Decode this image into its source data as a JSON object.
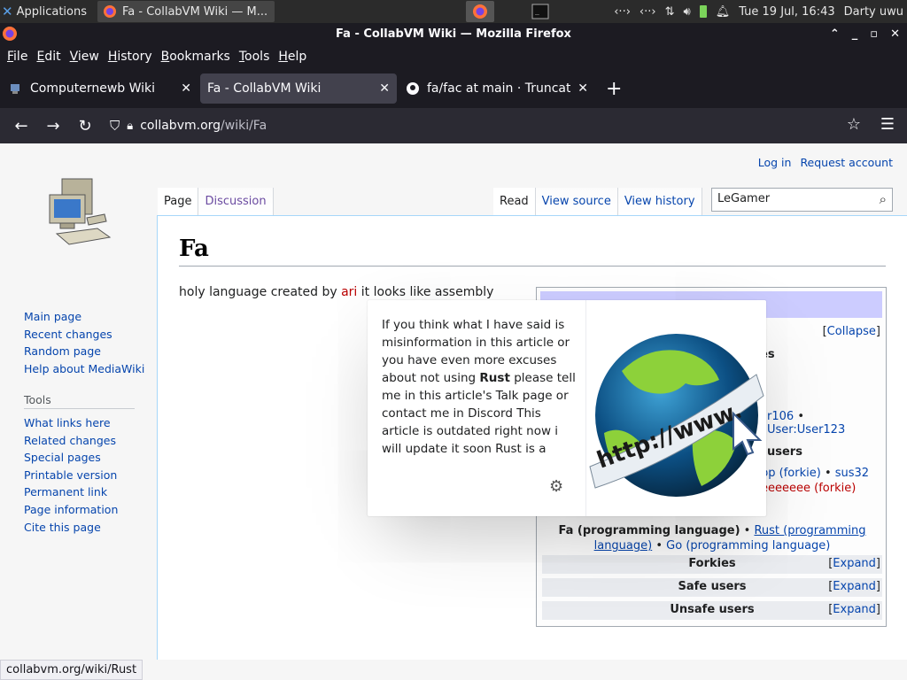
{
  "panel": {
    "apps_label": "Applications",
    "task_title": "Fa - CollabVM Wiki — M...",
    "datetime": "Tue 19 Jul, 16:43",
    "user": "Darty uwu"
  },
  "window": {
    "title": "Fa - CollabVM Wiki — Mozilla Firefox"
  },
  "menu": [
    "File",
    "Edit",
    "View",
    "History",
    "Bookmarks",
    "Tools",
    "Help"
  ],
  "tabs": [
    {
      "title": "Computernewb Wiki"
    },
    {
      "title": "Fa - CollabVM Wiki"
    },
    {
      "title": "fa/fac at main · TruncatedDinosour"
    }
  ],
  "url": {
    "host": "collabvm.org",
    "path": "/wiki/Fa"
  },
  "wiki": {
    "personal": [
      "Log in",
      "Request account"
    ],
    "nav": [
      "Main page",
      "Recent changes",
      "Random page",
      "Help about MediaWiki"
    ],
    "tools_heading": "Tools",
    "tools": [
      "What links here",
      "Related changes",
      "Special pages",
      "Printable version",
      "Permanent link",
      "Page information",
      "Cite this page"
    ],
    "tabs_left": [
      "Page",
      "Discussion"
    ],
    "tabs_right": [
      "Read",
      "View source",
      "View history"
    ],
    "search_value": "LeGamer",
    "heading": "Fa",
    "body_before": "holy language created by ",
    "body_link": "ari",
    "body_after": " it looks like assembly"
  },
  "navbox": {
    "collapse": "Collapse",
    "partial": {
      "a": "es",
      "b": "r106",
      "c": "User:User123",
      "d": "users",
      "e": "pp (forkie)",
      "f": "sus32",
      "g": "eeeeeee (forkie)"
    },
    "languages": {
      "current": "Fa (programming language)",
      "sep": " • ",
      "rust": "Rust (programming language)",
      "go": "Go (programming language)"
    },
    "rows": [
      {
        "label": "Forkies",
        "action": "Expand"
      },
      {
        "label": "Safe users",
        "action": "Expand"
      },
      {
        "label": "Unsafe users",
        "action": "Expand"
      }
    ]
  },
  "popup": {
    "text_1": "If you think what I have said is misinformation in this article or you have even more excuses about not using ",
    "bold": "Rust",
    "text_2": " please tell me in this article's Talk page or contact me in Discord This article is outdated right now i will update it soon Rust is a"
  },
  "status_url": "collabvm.org/wiki/Rust"
}
